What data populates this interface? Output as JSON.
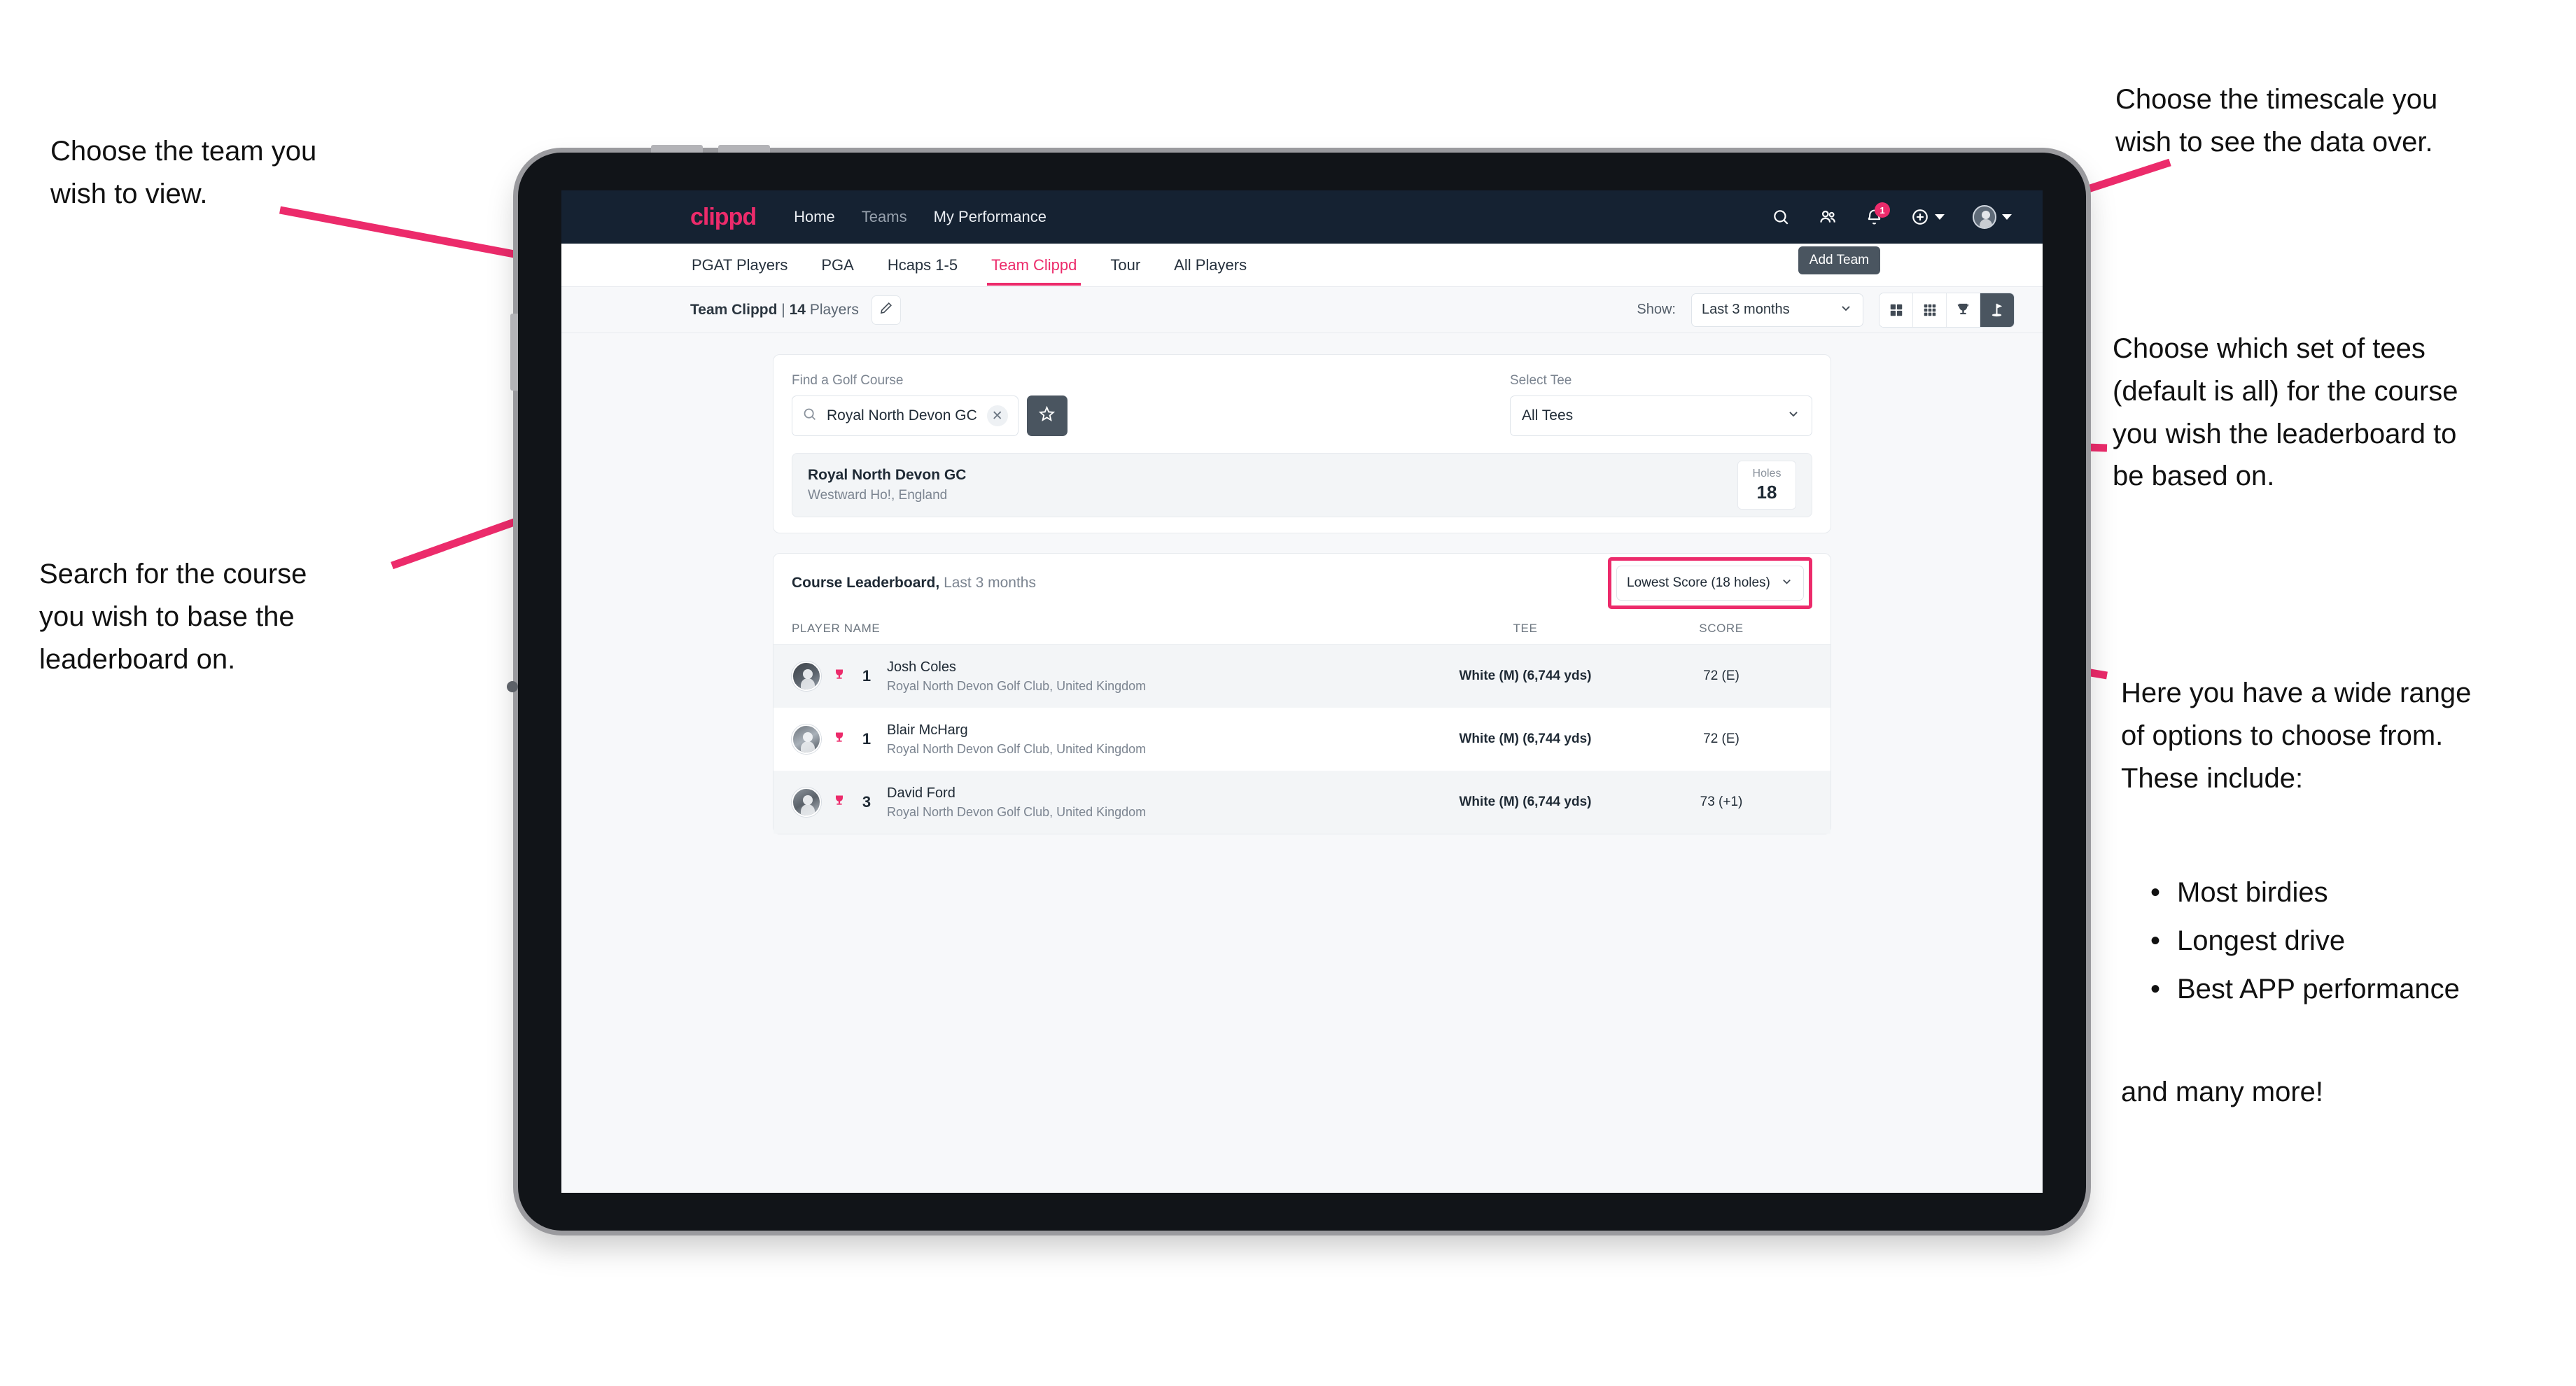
{
  "annotations": {
    "top_left": "Choose the team you\nwish to view.",
    "bottom_left": "Search for the course\nyou wish to base the\nleaderboard on.",
    "top_right": "Choose the timescale you\nwish to see the data over.",
    "mid_right": "Choose which set of tees\n(default is all) for the course\nyou wish the leaderboard to\nbe based on.",
    "bottom_right": "Here you have a wide range\nof options to choose from.\nThese include:",
    "bullets": [
      "Most birdies",
      "Longest drive",
      "Best APP performance"
    ],
    "closing": "and many more!",
    "arrow_color": "#ec2b6b"
  },
  "app": {
    "brand": "clippd",
    "nav_links": [
      {
        "label": "Home",
        "active": true
      },
      {
        "label": "Teams",
        "active": false
      },
      {
        "label": "My Performance",
        "active": true
      }
    ],
    "nav_icons": [
      {
        "name": "search-icon"
      },
      {
        "name": "people-icon"
      },
      {
        "name": "notifications-bell-icon",
        "badge": "1"
      },
      {
        "name": "add-circle-icon"
      },
      {
        "name": "user-avatar-icon"
      }
    ],
    "tabs": [
      {
        "label": "PGAT Players",
        "state": "normal"
      },
      {
        "label": "PGA",
        "state": "normal"
      },
      {
        "label": "Hcaps 1-5",
        "state": "normal"
      },
      {
        "label": "Team Clippd",
        "state": "active"
      },
      {
        "label": "Tour",
        "state": "normal"
      },
      {
        "label": "All Players",
        "state": "normal"
      }
    ],
    "tooltip_add_team": "Add Team",
    "subbar": {
      "team_name": "Team Clippd",
      "separator": "|",
      "player_count": "14",
      "players_word": "Players",
      "edit_icon": "pencil-icon",
      "show_label": "Show:",
      "timescale_value": "Last 3 months",
      "view_toggles": [
        {
          "name": "grid-4-view-icon",
          "active": false
        },
        {
          "name": "grid-9-view-icon",
          "active": false
        },
        {
          "name": "trophy-view-icon",
          "active": false
        },
        {
          "name": "golf-flag-view-icon",
          "active": true
        }
      ]
    },
    "search_card": {
      "course_label": "Find a Golf Course",
      "course_value": "Royal North Devon GC",
      "course_placeholder": "Find a Golf Course",
      "clear_icon": "close-icon",
      "search_icon": "search-icon",
      "favourite_icon": "star-icon",
      "tee_label": "Select Tee",
      "tee_value": "All Tees"
    },
    "course_result": {
      "name": "Royal North Devon GC",
      "location": "Westward Ho!, England",
      "holes_label": "Holes",
      "holes_value": "18"
    },
    "leaderboard": {
      "title": "Course Leaderboard,",
      "subtitle": "Last 3 months",
      "sort_value": "Lowest Score (18 holes)",
      "columns": [
        "PLAYER NAME",
        "TEE",
        "SCORE"
      ],
      "rows": [
        {
          "rank": "1",
          "name": "Josh Coles",
          "club": "Royal North Devon Golf Club, United Kingdom",
          "tee": "White (M) (6,744 yds)",
          "score": "72 (E)",
          "trophy_icon": "trophy-icon"
        },
        {
          "rank": "1",
          "name": "Blair McHarg",
          "club": "Royal North Devon Golf Club, United Kingdom",
          "tee": "White (M) (6,744 yds)",
          "score": "72 (E)",
          "trophy_icon": "trophy-icon"
        },
        {
          "rank": "3",
          "name": "David Ford",
          "club": "Royal North Devon Golf Club, United Kingdom",
          "tee": "White (M) (6,744 yds)",
          "score": "73 (+1)",
          "trophy_icon": "trophy-icon"
        }
      ]
    }
  }
}
